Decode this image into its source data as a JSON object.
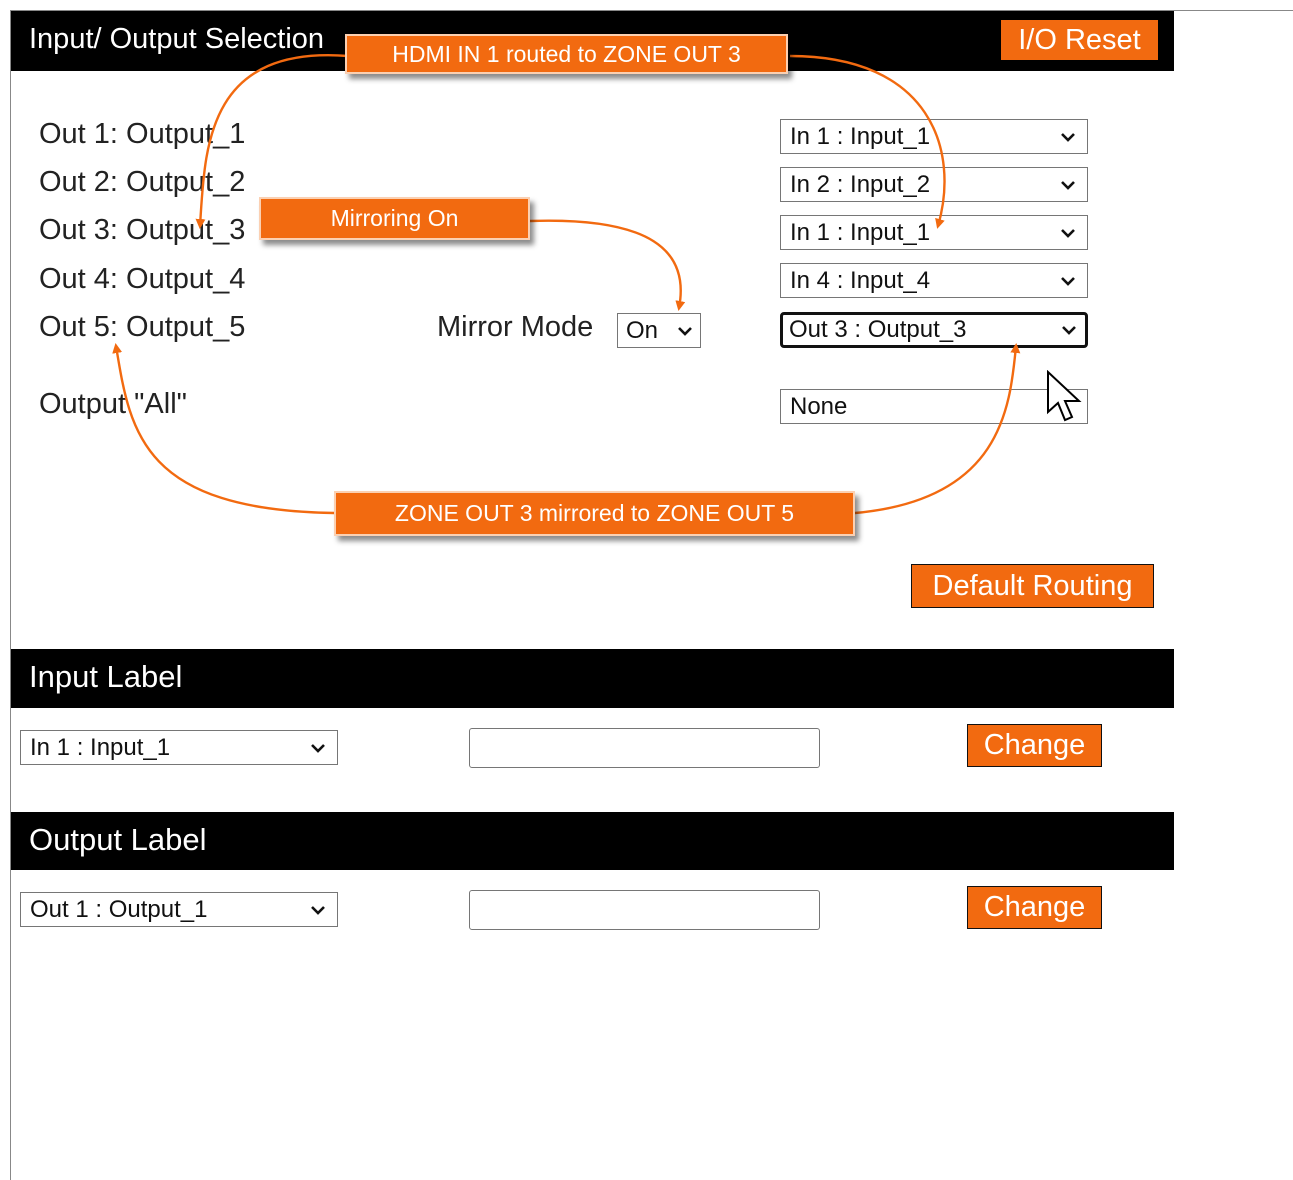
{
  "io_section": {
    "title": "Input/ Output Selection",
    "reset_button": "I/O Reset",
    "rows": [
      {
        "label": "Out 1: Output_1",
        "selected": "In 1 : Input_1"
      },
      {
        "label": "Out 2: Output_2",
        "selected": "In 2 : Input_2"
      },
      {
        "label": "Out 3: Output_3",
        "selected": "In 1 : Input_1"
      },
      {
        "label": "Out 4: Output_4",
        "selected": "In 4 : Input_4"
      },
      {
        "label": "Out 5: Output_5",
        "selected": "Out 3 : Output_3"
      }
    ],
    "mirror_mode": {
      "label": "Mirror Mode",
      "value": "On"
    },
    "all": {
      "label": "Output \"All\"",
      "selected": "None"
    },
    "default_button": "Default Routing"
  },
  "input_label": {
    "title": "Input Label",
    "selected": "In 1 : Input_1",
    "text_value": "",
    "change_button": "Change"
  },
  "output_label": {
    "title": "Output Label",
    "selected": "Out 1 : Output_1",
    "text_value": "",
    "change_button": "Change"
  },
  "callouts": {
    "hdmi": "HDMI IN 1 routed to ZONE OUT 3",
    "mirroring": "Mirroring On",
    "zone": "ZONE OUT 3 mirrored to ZONE OUT 5"
  },
  "colors": {
    "accent": "#f26a10",
    "bar": "#000000"
  },
  "icons": {
    "dropdown": "chevron-down-icon",
    "pointer": "mouse-cursor-icon"
  }
}
